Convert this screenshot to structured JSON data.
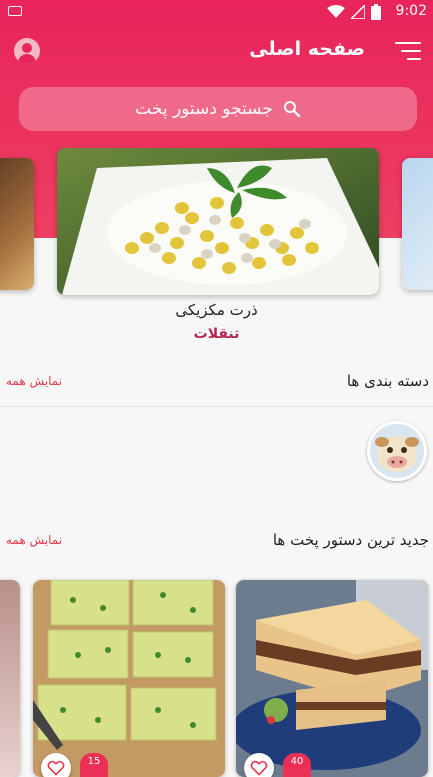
{
  "status_bar": {
    "time": "9:02"
  },
  "header": {
    "title": "صفحه اصلی"
  },
  "search": {
    "placeholder": "جستجو دستور پخت"
  },
  "slider": {
    "featured_title": "ذرت مکزیکی",
    "featured_category": "تنقلات"
  },
  "categories_section": {
    "title": "دسته بندی ها",
    "see_all": "نمایش همه"
  },
  "latest_section": {
    "title": "جدید ترین دستور پخت ها",
    "see_all": "نمایش همه"
  },
  "recipes": [
    {
      "likes": "40"
    },
    {
      "likes": "15"
    }
  ],
  "colors": {
    "brand": "#e8245a",
    "accent_text": "#b4254d",
    "link": "#e23a4c"
  },
  "icons": {
    "menu": "hamburger-menu-icon",
    "account": "account-circle-icon",
    "search": "search-icon",
    "like": "heart-outline-icon"
  }
}
